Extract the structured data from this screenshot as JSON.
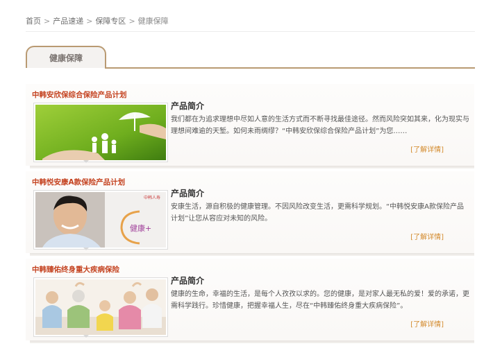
{
  "breadcrumb": {
    "items": [
      "首页",
      "产品速递",
      "保障专区",
      "健康保障"
    ],
    "separator": ">"
  },
  "tab": {
    "label": "健康保障"
  },
  "products": [
    {
      "title": "中韩安欣保综合保险产品计划",
      "intro_label": "产品简介",
      "description": "我们都在为追求理想中尽如人意的生活方式而不断寻找最佳途径。然而风险突如其来，化为现实与理想间难逾的天堑。如何未雨绸缪？“中韩安欣保综合保险产品计划”为您……",
      "more_label": "[了解详情]",
      "image": "hand-holding-umbrella-over-family"
    },
    {
      "title": "中韩悦安康A款保险产品计划",
      "intro_label": "产品简介",
      "description": "安康生活，源自积极的健康管理。不因风险改变生活，更需科学规划。“中韩悦安康A款保险产品计划”让您从容应对未知的风险。",
      "more_label": "[了解详情]",
      "image": "smiling-man-portrait",
      "image_text": "健康+"
    },
    {
      "title": "中韩臻佑终身重大疾病保险",
      "intro_label": "产品简介",
      "description": "健康的生命，幸福的生活，是每个人孜孜以求的。您的健康，是对家人最无私的爱！爱的承诺，更需科学践行。珍惜健康，把握幸福人生，尽在“中韩臻佑终身重大疾病保险”。",
      "more_label": "[了解详情]",
      "image": "family-group-photo"
    }
  ],
  "colors": {
    "accent": "#b99a72",
    "title_red": "#c4421f",
    "link_orange": "#d38a2c"
  }
}
